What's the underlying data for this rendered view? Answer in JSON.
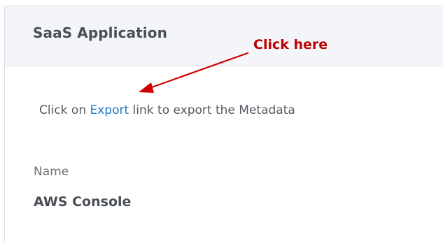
{
  "panel": {
    "title": "SaaS Application"
  },
  "annotation": {
    "label": "Click here",
    "color": "#c00000"
  },
  "instruction": {
    "prefix": "Click on ",
    "link_text": "Export",
    "suffix": " link to export the Metadata"
  },
  "field": {
    "label": "Name",
    "value": "AWS Console"
  },
  "colors": {
    "link": "#1e78c2",
    "header_bg": "#f3f5f8"
  }
}
